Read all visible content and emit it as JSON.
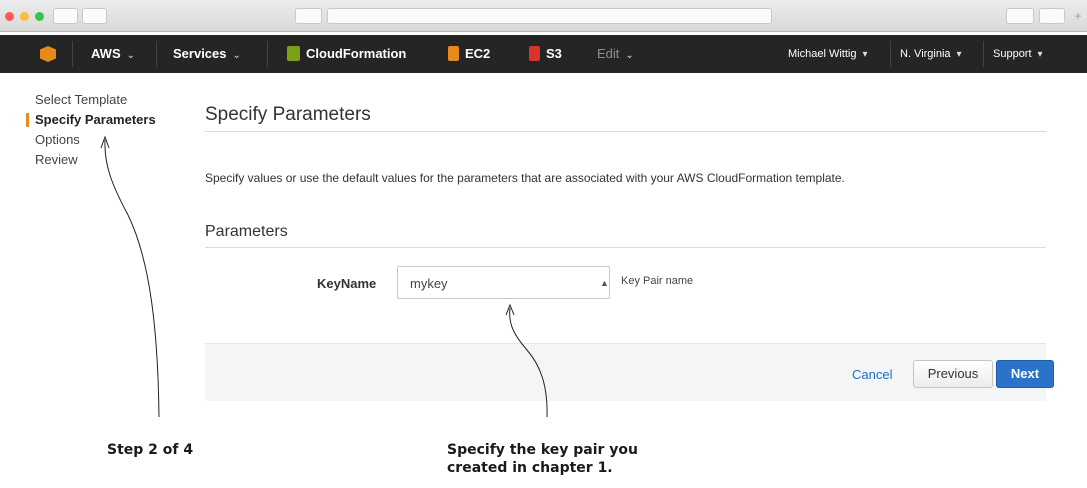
{
  "browser": {
    "traffic_light_colors": [
      "#fc5753",
      "#fdbc40",
      "#34c84a"
    ],
    "plus_glyph": "+"
  },
  "nav": {
    "aws": "AWS",
    "services": "Services",
    "cloudformation": "CloudFormation",
    "ec2": "EC2",
    "s3": "S3",
    "edit": "Edit",
    "user": "Michael Wittig",
    "region": "N. Virginia",
    "support": "Support",
    "caret": "⌄",
    "colors": {
      "cloudformation": "#7aa116",
      "ec2": "#e8891a",
      "s3": "#d9342b"
    }
  },
  "steps": [
    {
      "label": "Select Template"
    },
    {
      "label": "Specify Parameters"
    },
    {
      "label": "Options"
    },
    {
      "label": "Review"
    }
  ],
  "page": {
    "title": "Specify Parameters",
    "description": "Specify values or use the default values for the parameters that are associated with your AWS CloudFormation template.",
    "section_title": "Parameters",
    "field_label": "KeyName",
    "field_value": "mykey",
    "field_hint": "Key Pair name",
    "cancel": "Cancel",
    "previous": "Previous",
    "next": "Next"
  },
  "annotations": {
    "step": "Step 2 of 4",
    "keypair_line1": "Specify the key pair you",
    "keypair_line2": "created in chapter 1."
  }
}
